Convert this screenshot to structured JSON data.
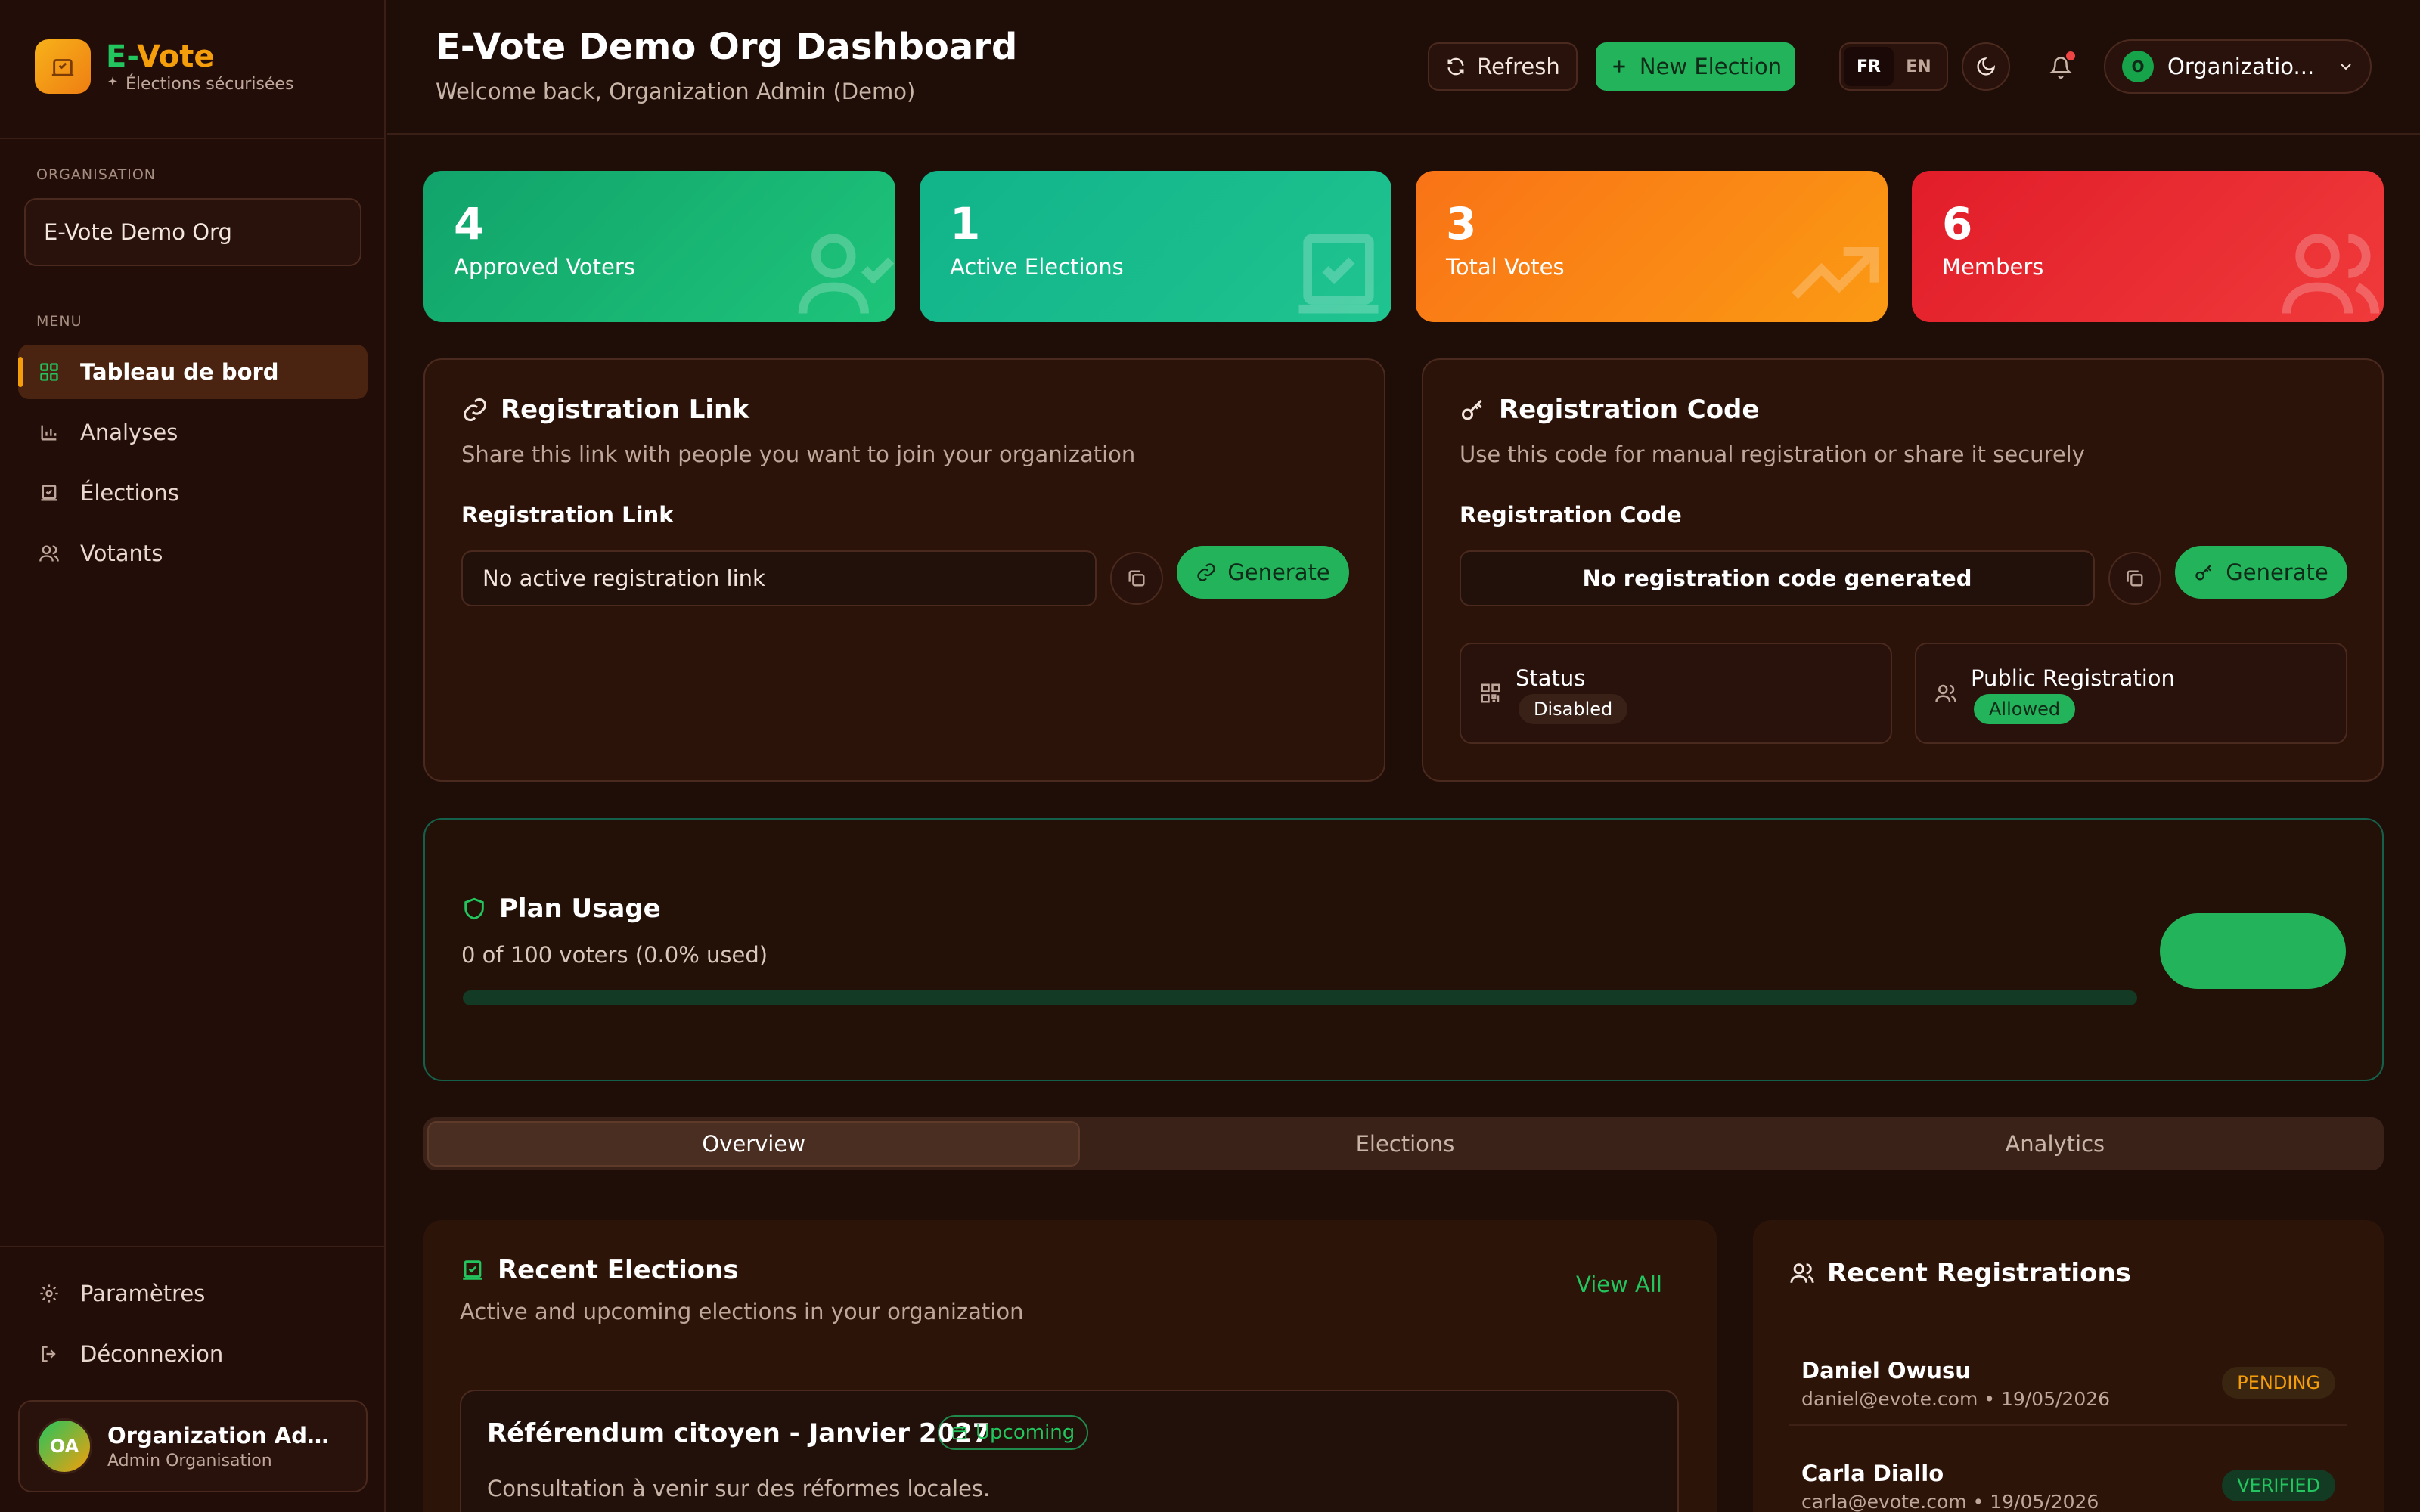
{
  "brand": {
    "name_part1": "E-",
    "name_part2": "Vote",
    "tagline": "Élections sécurisées"
  },
  "sidebar": {
    "org_label": "ORGANISATION",
    "org_name": "E-Vote Demo Org",
    "menu_label": "MENU",
    "items": [
      {
        "label": "Tableau de bord",
        "icon": "dashboard-icon",
        "active": true
      },
      {
        "label": "Analyses",
        "icon": "bar-chart-icon"
      },
      {
        "label": "Élections",
        "icon": "ballot-check-icon"
      },
      {
        "label": "Votants",
        "icon": "users-icon"
      }
    ],
    "bottom": [
      {
        "label": "Paramètres",
        "icon": "gear-icon"
      },
      {
        "label": "Déconnexion",
        "icon": "logout-icon"
      }
    ],
    "user": {
      "initials": "OA",
      "name": "Organization Admin (Demo)",
      "role": "Admin Organisation"
    }
  },
  "header": {
    "title": "E-Vote Demo Org Dashboard",
    "subtitle": "Welcome back, Organization Admin (Demo)",
    "refresh_label": "Refresh",
    "new_election_label": "New Election",
    "lang": [
      "FR",
      "EN"
    ],
    "org_initial": "O",
    "org_select": "Organizatio..."
  },
  "stats": [
    {
      "value": "4",
      "label": "Approved Voters",
      "icon": "user-check-icon"
    },
    {
      "value": "1",
      "label": "Active Elections",
      "icon": "ballot-check-icon"
    },
    {
      "value": "3",
      "label": "Total Votes",
      "icon": "trend-icon"
    },
    {
      "value": "6",
      "label": "Members",
      "icon": "users-icon"
    }
  ],
  "reg_link": {
    "title": "Registration Link",
    "desc": "Share this link with people you want to join your organization",
    "label": "Registration Link",
    "value": "No active registration link",
    "generate": "Generate"
  },
  "reg_code": {
    "title": "Registration Code",
    "desc": "Use this code for manual registration or share it securely",
    "label": "Registration Code",
    "value": "No registration code generated",
    "generate": "Generate",
    "status_label": "Status",
    "status_value": "Disabled",
    "public_label": "Public Registration",
    "public_value": "Allowed"
  },
  "plan": {
    "title": "Plan Usage",
    "usage": "0 of 100 voters (0.0% used)",
    "used_fraction": 0.0
  },
  "tabs": [
    "Overview",
    "Elections",
    "Analytics"
  ],
  "recent_elections": {
    "title": "Recent Elections",
    "desc": "Active and upcoming elections in your organization",
    "view_all": "View All",
    "items": [
      {
        "title": "Référendum citoyen - Janvier 2027",
        "badge": "Upcoming",
        "desc": "Consultation à venir sur des réformes locales."
      }
    ]
  },
  "recent_registrations": {
    "title": "Recent Registrations",
    "items": [
      {
        "name": "Daniel Owusu",
        "meta": "daniel@evote.com • 19/05/2026",
        "status": "PENDING"
      },
      {
        "name": "Carla Diallo",
        "meta": "carla@evote.com • 19/05/2026",
        "status": "VERIFIED"
      }
    ]
  },
  "colors": {
    "accent_green": "#22c55e",
    "accent_orange": "#f59e0b",
    "background": "#1f0d07"
  }
}
